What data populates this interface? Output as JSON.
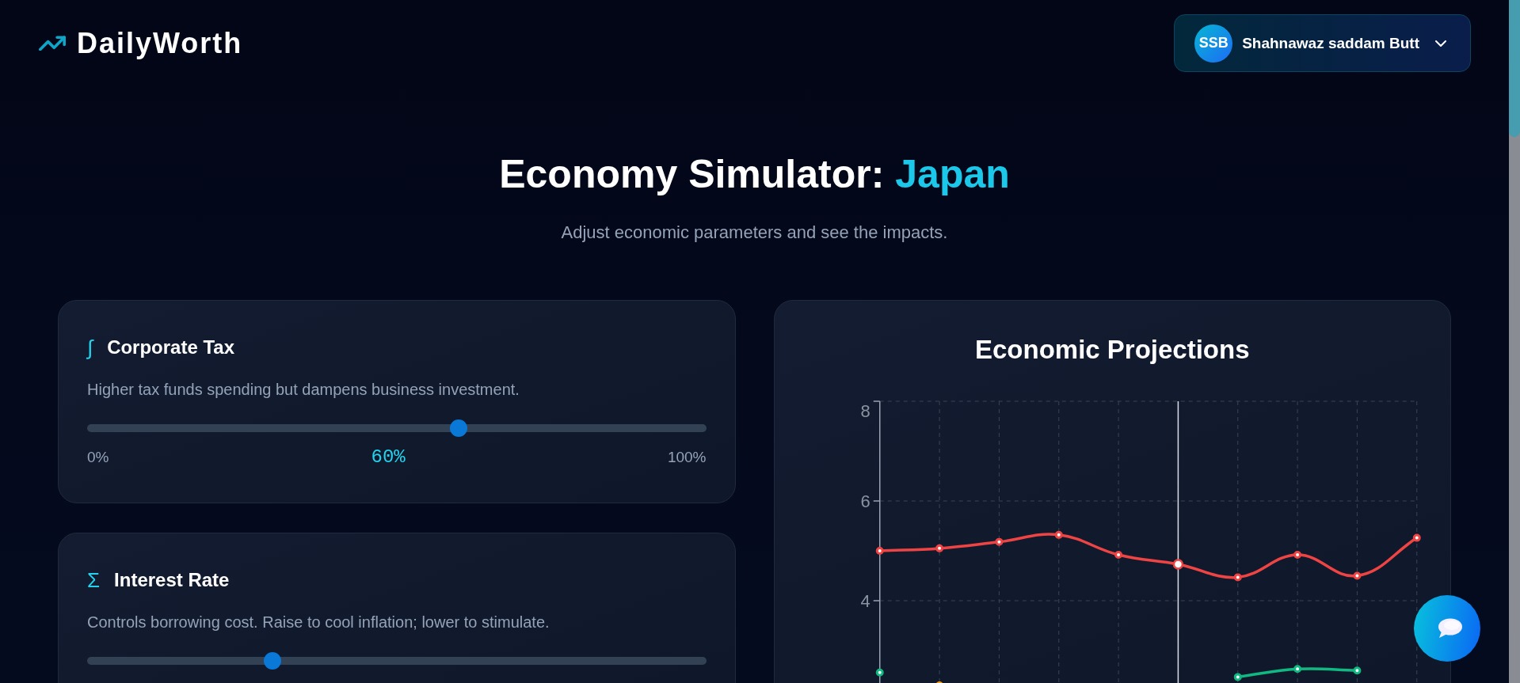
{
  "header": {
    "logo": "DailyWorth",
    "user": {
      "initials": "SSB",
      "name": "Shahnawaz saddam Butt"
    }
  },
  "hero": {
    "title": "Economy Simulator:",
    "country": "Japan",
    "subtitle": "Adjust economic parameters and see the impacts."
  },
  "controls": [
    {
      "symbol": "∫",
      "title": "Corporate Tax",
      "description": "Higher tax funds spending but dampens business investment.",
      "level": 0.6,
      "min_label": "0%",
      "value": "60%",
      "max_label": "100%"
    },
    {
      "symbol": "Σ",
      "title": "Interest Rate",
      "description": "Controls borrowing cost. Raise to cool inflation; lower to stimulate.",
      "level": 0.3
    }
  ],
  "projections": {
    "title": "Economic Projections",
    "chart_data": {
      "type": "line",
      "grid": true,
      "ylim": [
        2,
        8
      ],
      "yticks": [
        4,
        6,
        8
      ],
      "series": [
        {
          "color": "#ef4444",
          "marker": "circle",
          "values": [
            5.0,
            5.05,
            5.18,
            5.32,
            4.92,
            4.73,
            4.47,
            4.92,
            4.5,
            5.26
          ]
        },
        {
          "color": "#10b981",
          "marker": "circle",
          "values": [
            2.56,
            null,
            null,
            null,
            null,
            null,
            2.47,
            2.63,
            2.6,
            null
          ]
        },
        {
          "color": "#f59e0b",
          "marker": "circle",
          "values": [
            null,
            2.3,
            null,
            null,
            null,
            null,
            null,
            null,
            null,
            null
          ]
        }
      ]
    }
  }
}
